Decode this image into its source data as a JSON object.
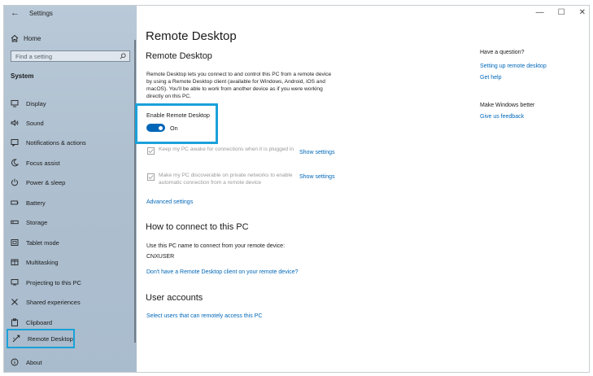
{
  "window": {
    "title": "Settings",
    "back_icon": "back-arrow-icon",
    "controls": {
      "minimize": "—",
      "maximize": "☐",
      "close": "✕"
    }
  },
  "sidebar": {
    "home": "Home",
    "search_placeholder": "Find a setting",
    "section": "System",
    "items": [
      {
        "label": "Display",
        "icon": "display-icon"
      },
      {
        "label": "Sound",
        "icon": "sound-icon"
      },
      {
        "label": "Notifications & actions",
        "icon": "notifications-icon"
      },
      {
        "label": "Focus assist",
        "icon": "moon-icon"
      },
      {
        "label": "Power & sleep",
        "icon": "power-icon"
      },
      {
        "label": "Battery",
        "icon": "battery-icon"
      },
      {
        "label": "Storage",
        "icon": "storage-icon"
      },
      {
        "label": "Tablet mode",
        "icon": "tablet-icon"
      },
      {
        "label": "Multitasking",
        "icon": "multitasking-icon"
      },
      {
        "label": "Projecting to this PC",
        "icon": "projecting-icon"
      },
      {
        "label": "Shared experiences",
        "icon": "shared-icon"
      },
      {
        "label": "Clipboard",
        "icon": "clipboard-icon"
      },
      {
        "label": "Remote Desktop",
        "icon": "remote-desktop-icon",
        "selected": true
      },
      {
        "label": "About",
        "icon": "info-icon"
      }
    ]
  },
  "main": {
    "page_title": "Remote Desktop",
    "section_title": "Remote Desktop",
    "description": "Remote Desktop lets you connect to and control this PC from a remote device by using a Remote Desktop client (available for Windows, Android, iOS and macOS). You'll be able to work from another device as if you were working directly on this PC.",
    "enable_label": "Enable Remote Desktop",
    "toggle_state": "On",
    "toggle_on": true,
    "option1": "Keep my PC awake for connections when it is plugged in",
    "option2": "Make my PC discoverable on private networks to enable automatic connection from a remote device",
    "show_settings": "Show settings",
    "advanced_settings": "Advanced settings",
    "how_to_title": "How to connect to this PC",
    "how_to_text": "Use this PC name to connect from your remote device:",
    "pc_name": "CNXUSER",
    "client_link": "Don't have a Remote Desktop client on your remote device?",
    "user_accounts_title": "User accounts",
    "select_users_link": "Select users that can remotely access this PC"
  },
  "right": {
    "question_title": "Have a question?",
    "setup_link": "Setting up remote desktop",
    "help_link": "Get help",
    "better_title": "Make Windows better",
    "feedback_link": "Give us feedback"
  },
  "colors": {
    "accent": "#0067b8",
    "highlight_box": "#1ba1d9",
    "sidebar": "#b1c2d2"
  }
}
